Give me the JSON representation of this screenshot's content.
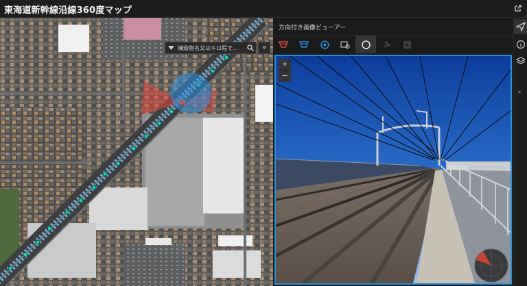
{
  "app": {
    "title": "東海道新幹線沿線360度マップ"
  },
  "map": {
    "search": {
      "placeholder": "構造物名又はキロ程で…"
    },
    "collapse_label": "»",
    "icons": [
      "filter-dropdown-icon",
      "search-icon",
      "collapse-panel-icon"
    ]
  },
  "viewer": {
    "title": "方向付き画像ビューアー",
    "tools": [
      {
        "name": "tool-camera-red",
        "color": "#e0463b"
      },
      {
        "name": "tool-camera-blue",
        "color": "#2d8fe0"
      },
      {
        "name": "tool-globe",
        "color": "#2d8fe0"
      },
      {
        "name": "tool-image-location",
        "color": "#bdbdbd"
      },
      {
        "name": "tool-compass",
        "color": "#ffffff"
      },
      {
        "name": "tool-pin-disabled",
        "color": "#555555"
      },
      {
        "name": "tool-layers-disabled",
        "color": "#555555"
      }
    ],
    "zoom_in_label": "+",
    "zoom_out_label": "−"
  },
  "rail": {
    "icons": [
      "send-icon",
      "info-icon",
      "layers-icon"
    ],
    "collapse_label": "«"
  },
  "colors": {
    "accent": "#2a90d8",
    "track_point": "#1ad2a8",
    "view_cone": "#e0463b"
  }
}
